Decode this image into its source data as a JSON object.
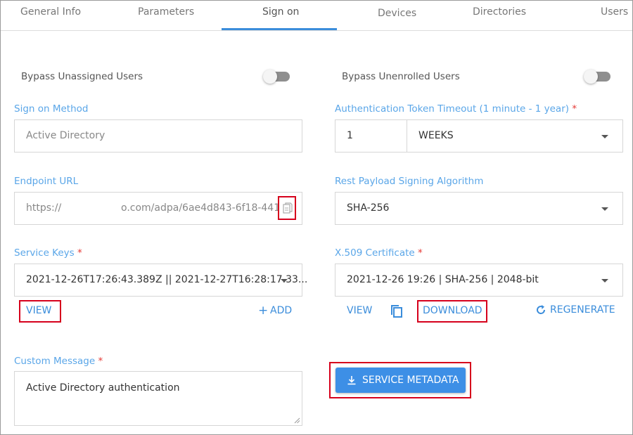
{
  "tabs": [
    "General Info",
    "Parameters",
    "Sign on",
    "Devices",
    "Directories",
    "Users"
  ],
  "active_tab": "Sign on",
  "bypass": {
    "unassigned_label": "Bypass Unassigned Users",
    "unenrolled_label": "Bypass Unenrolled Users",
    "unassigned_on": false,
    "unenrolled_on": false
  },
  "sign_on_method": {
    "label": "Sign on Method",
    "value": "Active Directory"
  },
  "token_timeout": {
    "label": "Authentication Token Timeout (1 minute - 1 year)",
    "required": "*",
    "amount": "1",
    "unit": "WEEKS"
  },
  "endpoint": {
    "label": "Endpoint URL",
    "prefix": "https://",
    "suffix": "o.com/adpa/6ae4d843-6f18-441"
  },
  "signing_algo": {
    "label": "Rest Payload Signing Algorithm",
    "value": "SHA-256"
  },
  "service_keys": {
    "label": "Service Keys",
    "required": "*",
    "value": "2021-12-26T17:26:43.389Z || 2021-12-27T16:28:17.33...",
    "view": "VIEW",
    "add": "ADD"
  },
  "certificate": {
    "label": "X.509 Certificate",
    "required": "*",
    "value": "2021-12-26 19:26 | SHA-256 | 2048-bit",
    "view": "VIEW",
    "download": "DOWNLOAD",
    "regenerate": "REGENERATE"
  },
  "custom_message": {
    "label": "Custom Message",
    "required": "*",
    "value": "Active Directory authentication"
  },
  "service_metadata_button": "SERVICE METADATA",
  "colors": {
    "accent": "#3b8ddb",
    "label": "#5aa6e8",
    "required": "#e53935",
    "highlight": "#d6001c",
    "button": "#3d8fe6"
  }
}
